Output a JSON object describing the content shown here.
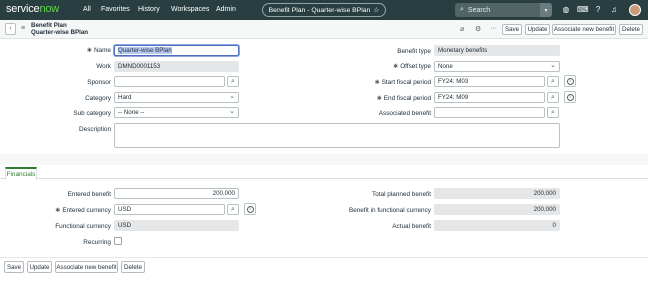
{
  "nav": {
    "logo_main": "service",
    "logo_accent": "now",
    "links": [
      "All",
      "Favorites",
      "History",
      "Workspaces",
      "Admin"
    ],
    "context_title": "Benefit Plan - Quarter-wise BPlan",
    "search_placeholder": "Search"
  },
  "header": {
    "line1": "Benefit Plan",
    "line2": "Quarter-wise BPlan",
    "buttons": {
      "save": "Save",
      "update": "Update",
      "associate": "Associate new benefit",
      "delete": "Delete"
    }
  },
  "form": {
    "name_label": "Name",
    "name_value": "Quarter-wise BPlan",
    "work_label": "Work",
    "work_value": "DMND0001153",
    "sponsor_label": "Sponsor",
    "sponsor_value": "",
    "category_label": "Category",
    "category_value": "Hard",
    "subcategory_label": "Sub category",
    "subcategory_value": "-- None --",
    "description_label": "Description",
    "benefit_type_label": "Benefit type",
    "benefit_type_value": "Monetary benefits",
    "offset_type_label": "Offset type",
    "offset_type_value": "None",
    "start_label": "Start fiscal period",
    "start_value": "FY24: M03",
    "end_label": "End fiscal period",
    "end_value": "FY24: M09",
    "assoc_label": "Associated benefit",
    "assoc_value": ""
  },
  "tabs": {
    "financials": "Financials"
  },
  "financials": {
    "entered_benefit_label": "Entered benefit",
    "entered_benefit_value": "200,000",
    "entered_currency_label": "Entered currency",
    "entered_currency_value": "USD",
    "functional_currency_label": "Functional currency",
    "functional_currency_value": "USD",
    "recurring_label": "Recurring",
    "total_planned_label": "Total planned benefit",
    "total_planned_value": "200,000",
    "functional_benefit_label": "Benefit in functional currency",
    "functional_benefit_value": "200,000",
    "actual_label": "Actual benefit",
    "actual_value": "0"
  },
  "footer": {
    "save": "Save",
    "update": "Update",
    "associate": "Associate new benefit",
    "delete": "Delete"
  }
}
